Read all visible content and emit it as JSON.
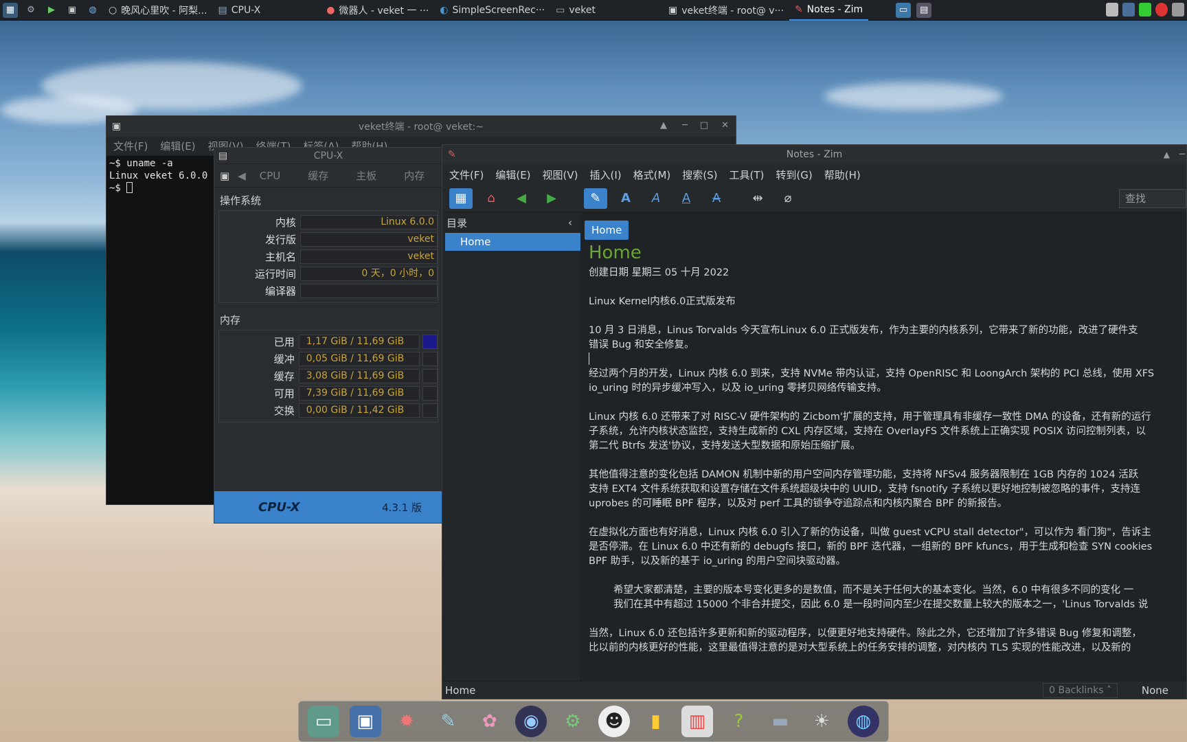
{
  "taskbar": {
    "tasks": [
      {
        "label": "晚风心里吹 - 阿梨...",
        "icon": "circle-icon"
      },
      {
        "label": "CPU-X",
        "icon": "cpu-icon"
      },
      {
        "label": "微器人 - veket 一 ···",
        "icon": "firefox-icon"
      },
      {
        "label": "SimpleScreenRec···",
        "icon": "recorder-icon"
      },
      {
        "label": "veket",
        "icon": "folder-icon"
      },
      {
        "label": "veket终端 - root@ v···",
        "icon": "terminal-icon"
      },
      {
        "label": "Notes - Zim",
        "icon": "zim-icon"
      }
    ]
  },
  "terminal": {
    "title": "veket终端 - root@ veket:~",
    "menu": [
      "文件(F)",
      "编辑(E)",
      "视图(V)",
      "终端(T)",
      "标签(A)",
      "帮助(H)"
    ],
    "lines": [
      "~$ uname -a",
      "Linux veket 6.0.0",
      "~$ "
    ]
  },
  "cpux": {
    "title": "CPU-X",
    "tabs": [
      "CPU",
      "缓存",
      "主板",
      "内存"
    ],
    "os_section": "操作系统",
    "os_rows": [
      {
        "label": "内核",
        "value": "Linux 6.0.0"
      },
      {
        "label": "发行版",
        "value": "veket"
      },
      {
        "label": "主机名",
        "value": "veket"
      },
      {
        "label": "运行时间",
        "value": "0 天，0 小时，0"
      },
      {
        "label": "编译器",
        "value": ""
      }
    ],
    "mem_section": "内存",
    "mem_rows": [
      {
        "label": "已用",
        "value": "1,17 GiB / 11,69 GiB",
        "fraction": 0.1
      },
      {
        "label": "缓冲",
        "value": "0,05 GiB / 11,69 GiB",
        "fraction": 0.0
      },
      {
        "label": "缓存",
        "value": "3,08 GiB / 11,69 GiB",
        "fraction": 0.0
      },
      {
        "label": "可用",
        "value": "7,39 GiB / 11,69 GiB",
        "fraction": 0.0
      },
      {
        "label": "交换",
        "value": "0,00 GiB / 11,42 GiB",
        "fraction": 0.0
      }
    ],
    "footer_logo": "CPU-X",
    "footer_version": "4.3.1 版"
  },
  "zim": {
    "title": "Notes - Zim",
    "menu": [
      "文件(F)",
      "编辑(E)",
      "视图(V)",
      "插入(I)",
      "格式(M)",
      "搜索(S)",
      "工具(T)",
      "转到(G)",
      "帮助(H)"
    ],
    "search_placeholder": "查找",
    "sidebar_title": "目录",
    "sidebar_items": [
      "Home"
    ],
    "breadcrumb": "Home",
    "page_title": "Home",
    "created": "创建日期 星期三 05 十月 2022",
    "paragraphs": [
      "Linux Kernel内核6.0正式版发布",
      "10 月 3 日消息，Linus Torvalds 今天宣布Linux 6.0 正式版发布，作为主要的内核系列，它带来了新的功能，改进了硬件支\n错误 Bug 和安全修复。",
      "经过两个月的开发，Linux 内核 6.0 到来，支持 NVMe 带内认证，支持 OpenRISC 和 LoongArch 架构的 PCI 总线，使用 XFS\nio_uring 时的异步缓冲写入，以及 io_uring 零拷贝网络传输支持。",
      "Linux 内核 6.0 还带来了对 RISC-V 硬件架构的 Zicbom'扩展的支持，用于管理具有非缓存一致性 DMA 的设备，还有新的运行\n子系统，允许内核状态监控，支持生成新的 CXL 内存区域，支持在 OverlayFS 文件系统上正确实现 POSIX 访问控制列表，以\n第二代 Btrfs 发送'协议，支持发送大型数据和原始压缩扩展。",
      "其他值得注意的变化包括 DAMON 机制中新的用户空间内存管理功能，支持将 NFSv4 服务器限制在 1GB 内存的 1024 活跃\n支持 EXT4 文件系统获取和设置存储在文件系统超级块中的 UUID，支持 fsnotify 子系统以更好地控制被忽略的事件，支持连\nuprobes 的可睡眠 BPF 程序，以及对 perf 工具的锁争夺追踪点和内核内聚合 BPF 的新报告。",
      "在虚拟化方面也有好消息，Linux 内核 6.0 引入了新的伪设备，叫做 guest vCPU stall detector\"，可以作为 看门狗\"，告诉主\n是否停滞。在 Linux 6.0 中还有新的 debugfs 接口，新的 BPF 迭代器，一组新的 BPF kfuncs，用于生成和检查 SYN cookies\nBPF 助手，以及新的基于 io_uring 的用户空间块驱动器。"
    ],
    "indent_paragraph": "希望大家都清楚，主要的版本号变化更多的是数值，而不是关于任何大的基本变化。当然，6.0 中有很多不同的变化 一\n我们在其中有超过 15000 个非合并提交，因此 6.0 是一段时间内至少在提交数量上较大的版本之一，'Linus Torvalds 说",
    "last_paragraph": "当然，Linux 6.0 还包括许多更新和新的驱动程序，以便更好地支持硬件。除此之外，它还增加了许多错误 Bug 修复和调整，\n比以前的内核更好的性能，这里最值得注意的是对大型系统上的任务安排的调整，对内核内 TLS 实现的性能改进，以及新的",
    "status_page": "Home",
    "backlinks": "0 Backlinks",
    "status_none": "None"
  },
  "colors": {
    "accent": "#3a82c9",
    "heading_green": "#6aa632",
    "value_gold": "#c9a53a",
    "mem_bar": "#1b1a8a"
  }
}
